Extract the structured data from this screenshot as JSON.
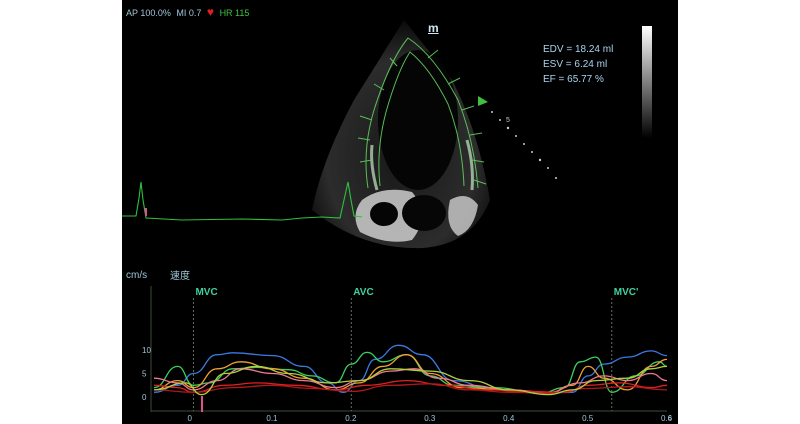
{
  "header": {
    "ap": "AP 100.0%",
    "mi": "MI 0.7",
    "hr": "HR 115"
  },
  "probe_marker": "m",
  "depth_label": "5",
  "metrics": {
    "edv": "EDV = 18.24 ml",
    "esv": "ESV = 6.24 ml",
    "ef": "EF  = 65.77 %"
  },
  "plot": {
    "y_unit": "cm/s",
    "y_title": "速度",
    "x_unit": "s",
    "y_ticks": [
      "0",
      "5",
      "10"
    ],
    "x_ticks": [
      "0",
      "0.1",
      "0.2",
      "0.3",
      "0.4",
      "0.5",
      "0.6"
    ],
    "events": [
      {
        "label": "MVC",
        "t": 0.0
      },
      {
        "label": "AVC",
        "t": 0.2
      },
      {
        "label": "MVC'",
        "t": 0.53
      }
    ]
  },
  "colors": {
    "ecg": "#30c040",
    "blue": "#3a7be0",
    "green": "#3cd060",
    "orange": "#f0a030",
    "pink": "#f07890",
    "red": "#e02020",
    "darkred": "#b01818",
    "yellowgreen": "#b0d040",
    "marker": "#e05090"
  },
  "chart_data": {
    "type": "line",
    "x_range": [
      -0.05,
      0.6
    ],
    "ylim": [
      -1,
      11
    ],
    "series": [
      {
        "color": "blue",
        "x": [
          -0.05,
          -0.02,
          0.0,
          0.03,
          0.05,
          0.1,
          0.14,
          0.17,
          0.19,
          0.21,
          0.23,
          0.26,
          0.29,
          0.33,
          0.38,
          0.42,
          0.45,
          0.48,
          0.5,
          0.52,
          0.55,
          0.58,
          0.6
        ],
        "y": [
          1.0,
          2.5,
          5.0,
          9.0,
          9.4,
          8.8,
          6.5,
          3.0,
          1.0,
          3.5,
          8.0,
          11.0,
          9.0,
          3.5,
          1.5,
          1.2,
          0.9,
          1.0,
          4.5,
          7.0,
          8.5,
          9.8,
          8.8
        ]
      },
      {
        "color": "green",
        "x": [
          -0.05,
          -0.02,
          0.0,
          0.02,
          0.05,
          0.08,
          0.12,
          0.15,
          0.18,
          0.2,
          0.22,
          0.24,
          0.27,
          0.3,
          0.33,
          0.38,
          0.44,
          0.47,
          0.49,
          0.51,
          0.53,
          0.56,
          0.59,
          0.6
        ],
        "y": [
          2.0,
          6.5,
          2.5,
          3.0,
          6.0,
          6.3,
          5.8,
          4.5,
          3.0,
          7.0,
          9.5,
          7.5,
          9.0,
          4.5,
          2.5,
          2.0,
          0.8,
          2.0,
          7.5,
          8.5,
          1.0,
          4.5,
          7.5,
          6.5
        ]
      },
      {
        "color": "orange",
        "x": [
          -0.05,
          -0.02,
          0.0,
          0.03,
          0.06,
          0.1,
          0.14,
          0.18,
          0.21,
          0.24,
          0.27,
          0.3,
          0.34,
          0.4,
          0.45,
          0.48,
          0.5,
          0.52,
          0.55,
          0.58,
          0.6
        ],
        "y": [
          1.5,
          3.5,
          2.0,
          6.0,
          7.5,
          6.0,
          4.0,
          1.5,
          3.0,
          6.5,
          9.0,
          5.0,
          2.0,
          1.5,
          0.8,
          2.5,
          6.5,
          4.0,
          1.5,
          6.5,
          8.0
        ]
      },
      {
        "color": "pink",
        "x": [
          -0.05,
          -0.02,
          0.0,
          0.03,
          0.06,
          0.1,
          0.14,
          0.18,
          0.21,
          0.25,
          0.28,
          0.31,
          0.35,
          0.4,
          0.45,
          0.49,
          0.52,
          0.55,
          0.58,
          0.6
        ],
        "y": [
          4.0,
          3.0,
          1.5,
          3.5,
          6.0,
          5.0,
          3.5,
          2.0,
          3.5,
          5.5,
          6.0,
          4.0,
          2.5,
          1.5,
          1.0,
          3.0,
          4.5,
          3.5,
          5.0,
          3.5
        ]
      },
      {
        "color": "red",
        "x": [
          -0.05,
          -0.02,
          0.0,
          0.04,
          0.08,
          0.13,
          0.18,
          0.22,
          0.27,
          0.32,
          0.37,
          0.42,
          0.47,
          0.5,
          0.54,
          0.58,
          0.6
        ],
        "y": [
          2.5,
          2.0,
          1.0,
          2.5,
          3.0,
          2.5,
          1.5,
          2.5,
          3.5,
          2.5,
          1.5,
          1.2,
          1.0,
          2.5,
          3.0,
          2.0,
          2.5
        ]
      },
      {
        "color": "darkred",
        "x": [
          -0.05,
          0.0,
          0.05,
          0.1,
          0.15,
          0.2,
          0.25,
          0.3,
          0.35,
          0.4,
          0.45,
          0.5,
          0.55,
          0.6
        ],
        "y": [
          1.5,
          1.0,
          2.0,
          2.5,
          1.8,
          1.2,
          2.5,
          2.8,
          1.5,
          1.0,
          0.8,
          1.8,
          2.2,
          1.5
        ]
      },
      {
        "color": "yellowgreen",
        "x": [
          -0.05,
          -0.01,
          0.01,
          0.04,
          0.08,
          0.12,
          0.17,
          0.21,
          0.25,
          0.3,
          0.35,
          0.4,
          0.45,
          0.48,
          0.51,
          0.55,
          0.58,
          0.6
        ],
        "y": [
          1.5,
          3.0,
          0.5,
          5.0,
          6.5,
          5.0,
          3.0,
          3.5,
          6.0,
          5.5,
          3.5,
          1.5,
          0.5,
          1.5,
          3.5,
          4.0,
          6.0,
          6.5
        ]
      }
    ]
  }
}
